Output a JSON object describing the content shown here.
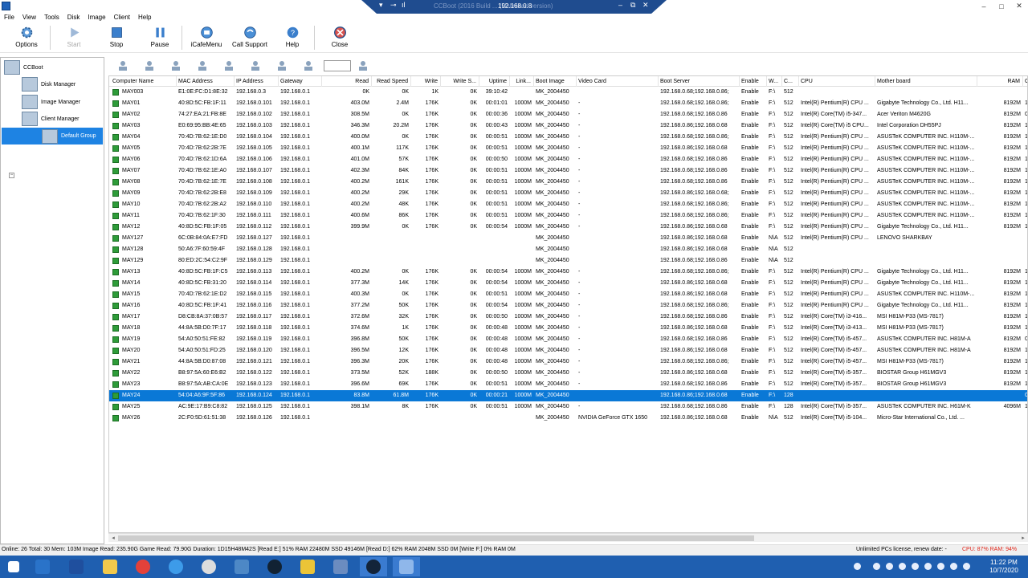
{
  "window": {
    "remote_title": "CCBoot (2016 Build ... (Unlimited version)",
    "remote_ip": "192.168.0.8"
  },
  "menu": [
    "File",
    "View",
    "Tools",
    "Disk",
    "Image",
    "Client",
    "Help"
  ],
  "toolbar": [
    {
      "label": "Options",
      "icon": "gear-icon"
    },
    {
      "label": "Start",
      "icon": "play-icon"
    },
    {
      "label": "Stop",
      "icon": "stop-icon"
    },
    {
      "label": "Pause",
      "icon": "pause-icon"
    },
    {
      "label": "iCafeMenu",
      "icon": "icafe-icon"
    },
    {
      "label": "Call Support",
      "icon": "support-icon"
    },
    {
      "label": "Help",
      "icon": "help-icon"
    },
    {
      "label": "Close",
      "icon": "close-icon"
    }
  ],
  "tree": {
    "root": "CCBoot",
    "disk_manager": "Disk Manager",
    "image_manager": "Image Manager",
    "client_manager": "Client Manager",
    "default_group": "Default Group",
    "expander": "−"
  },
  "columns": [
    "Computer Name",
    "MAC Address",
    "IP Address",
    "Gateway",
    "Read",
    "Read Speed",
    "Write",
    "Write S...",
    "Uptime",
    "Link...",
    "Boot Image",
    "Video Card",
    "Boot Server",
    "Enable",
    "W...",
    "C...",
    "CPU",
    "Mother board",
    "RAM",
    "C"
  ],
  "rows": [
    [
      "MAY003",
      "E1:0E:FC:D1:8E:32",
      "192.168.0.3",
      "192.168.0.1",
      "0K",
      "0K",
      "1K",
      "0K",
      "39:10:42",
      "",
      "MK_2004450",
      "",
      "192.168.0.68;192.168.0.86;",
      "Enable",
      "F:\\",
      "512",
      "",
      "",
      "",
      ""
    ],
    [
      "MAY01",
      "40:8D:5C:FB:1F:11",
      "192.168.0.101",
      "192.168.0.1",
      "403.0M",
      "2.4M",
      "176K",
      "0K",
      "00:01:01",
      "1000M",
      "MK_2004450",
      "-",
      "192.168.0.68;192.168.0.86;",
      "Enable",
      "F:\\",
      "512",
      "Intel(R) Pentium(R) CPU ...",
      "Gigabyte Technology Co., Ltd. H11...",
      "8192M",
      "1"
    ],
    [
      "MAY02",
      "74:27:EA:21:FB:8E",
      "192.168.0.102",
      "192.168.0.1",
      "308.5M",
      "0K",
      "176K",
      "0K",
      "00:00:36",
      "1000M",
      "MK_2004450",
      "-",
      "192.168.0.68;192.168.0.86",
      "Enable",
      "F:\\",
      "512",
      "Intel(R) Core(TM) i5-347...",
      "Acer Veriton M4620G",
      "8192M",
      "0"
    ],
    [
      "MAY03",
      "E0:69:95:BB:4E:65",
      "192.168.0.103",
      "192.168.0.1",
      "346.3M",
      "20.2M",
      "176K",
      "0K",
      "00:00:43",
      "1000M",
      "MK_2004450",
      "-",
      "192.168.0.86;192.168.0.68",
      "Enable",
      "F:\\",
      "512",
      "Intel(R) Core(TM) i5 CPU...",
      "Intel Corporation DH55PJ",
      "8192M",
      "1"
    ],
    [
      "MAY04",
      "70:4D:7B:62:1E:D0",
      "192.168.0.104",
      "192.168.0.1",
      "400.0M",
      "0K",
      "176K",
      "0K",
      "00:00:51",
      "1000M",
      "MK_2004450",
      "-",
      "192.168.0.68;192.168.0.86;",
      "Enable",
      "F:\\",
      "512",
      "Intel(R) Pentium(R) CPU ...",
      "ASUSTeK COMPUTER INC. H110M-...",
      "8192M",
      "1"
    ],
    [
      "MAY05",
      "70:4D:7B:62:2B:7E",
      "192.168.0.105",
      "192.168.0.1",
      "400.1M",
      "117K",
      "176K",
      "0K",
      "00:00:51",
      "1000M",
      "MK_2004450",
      "-",
      "192.168.0.86;192.168.0.68",
      "Enable",
      "F:\\",
      "512",
      "Intel(R) Pentium(R) CPU ...",
      "ASUSTeK COMPUTER INC. H110M-...",
      "8192M",
      "1"
    ],
    [
      "MAY06",
      "70:4D:7B:62:1D:6A",
      "192.168.0.106",
      "192.168.0.1",
      "401.0M",
      "57K",
      "176K",
      "0K",
      "00:00:50",
      "1000M",
      "MK_2004450",
      "-",
      "192.168.0.68;192.168.0.86",
      "Enable",
      "F:\\",
      "512",
      "Intel(R) Pentium(R) CPU ...",
      "ASUSTeK COMPUTER INC. H110M-...",
      "8192M",
      "1"
    ],
    [
      "MAY07",
      "70:4D:7B:62:1E:A0",
      "192.168.0.107",
      "192.168.0.1",
      "402.3M",
      "84K",
      "176K",
      "0K",
      "00:00:51",
      "1000M",
      "MK_2004450",
      "-",
      "192.168.0.68;192.168.0.86",
      "Enable",
      "F:\\",
      "512",
      "Intel(R) Pentium(R) CPU ...",
      "ASUSTeK COMPUTER INC. H110M-...",
      "8192M",
      "1"
    ],
    [
      "MAY08",
      "70:4D:7B:62:1E:7E",
      "192.168.0.108",
      "192.168.0.1",
      "400.2M",
      "161K",
      "176K",
      "0K",
      "00:00:51",
      "1000M",
      "MK_2004450",
      "-",
      "192.168.0.68;192.168.0.86",
      "Enable",
      "F:\\",
      "512",
      "Intel(R) Pentium(R) CPU ...",
      "ASUSTeK COMPUTER INC. H110M-...",
      "8192M",
      "1"
    ],
    [
      "MAY09",
      "70:4D:7B:62:2B:E8",
      "192.168.0.109",
      "192.168.0.1",
      "400.2M",
      "29K",
      "176K",
      "0K",
      "00:00:51",
      "1000M",
      "MK_2004450",
      "-",
      "192.168.0.86;192.168.0.68;",
      "Enable",
      "F:\\",
      "512",
      "Intel(R) Pentium(R) CPU ...",
      "ASUSTeK COMPUTER INC. H110M-...",
      "8192M",
      "1"
    ],
    [
      "MAY10",
      "70:4D:7B:62:2B:A2",
      "192.168.0.110",
      "192.168.0.1",
      "400.2M",
      "48K",
      "176K",
      "0K",
      "00:00:51",
      "1000M",
      "MK_2004450",
      "-",
      "192.168.0.68;192.168.0.86;",
      "Enable",
      "F:\\",
      "512",
      "Intel(R) Pentium(R) CPU ...",
      "ASUSTeK COMPUTER INC. H110M-...",
      "8192M",
      "1"
    ],
    [
      "MAY11",
      "70:4D:7B:62:1F:30",
      "192.168.0.111",
      "192.168.0.1",
      "400.6M",
      "86K",
      "176K",
      "0K",
      "00:00:51",
      "1000M",
      "MK_2004450",
      "-",
      "192.168.0.68;192.168.0.86;",
      "Enable",
      "F:\\",
      "512",
      "Intel(R) Pentium(R) CPU ...",
      "ASUSTeK COMPUTER INC. H110M-...",
      "8192M",
      "1"
    ],
    [
      "MAY12",
      "40:8D:5C:FB:1F:05",
      "192.168.0.112",
      "192.168.0.1",
      "399.9M",
      "0K",
      "176K",
      "0K",
      "00:00:54",
      "1000M",
      "MK_2004450",
      "-",
      "192.168.0.86;192.168.0.68",
      "Enable",
      "F:\\",
      "512",
      "Intel(R) Pentium(R) CPU ...",
      "Gigabyte Technology Co., Ltd. H11...",
      "8192M",
      "1"
    ],
    [
      "MAY127",
      "6C:0B:84:0A:E7:FD",
      "192.168.0.127",
      "192.168.0.1",
      "",
      "",
      "",
      "",
      "",
      "",
      "MK_2004450",
      "",
      "192.168.0.86;192.168.0.68",
      "Enable",
      "N\\A",
      "512",
      "Intel(R) Pentium(R) CPU ...",
      "LENOVO SHARKBAY",
      "",
      ""
    ],
    [
      "MAY128",
      "50:A6:7F:60:59:4F",
      "192.168.0.128",
      "192.168.0.1",
      "",
      "",
      "",
      "",
      "",
      "",
      "MK_2004450",
      "",
      "192.168.0.86;192.168.0.68",
      "Enable",
      "N\\A",
      "512",
      "",
      "",
      "",
      ""
    ],
    [
      "MAY129",
      "80:ED:2C:54:C2:9F",
      "192.168.0.129",
      "192.168.0.1",
      "",
      "",
      "",
      "",
      "",
      "",
      "MK_2004450",
      "",
      "192.168.0.68;192.168.0.86",
      "Enable",
      "N\\A",
      "512",
      "",
      "",
      "",
      ""
    ],
    [
      "MAY13",
      "40:8D:5C:FB:1F:C5",
      "192.168.0.113",
      "192.168.0.1",
      "400.2M",
      "0K",
      "176K",
      "0K",
      "00:00:54",
      "1000M",
      "MK_2004450",
      "-",
      "192.168.0.68;192.168.0.86;",
      "Enable",
      "F:\\",
      "512",
      "Intel(R) Pentium(R) CPU ...",
      "Gigabyte Technology Co., Ltd. H11...",
      "8192M",
      "1"
    ],
    [
      "MAY14",
      "40:8D:5C:FB:31:20",
      "192.168.0.114",
      "192.168.0.1",
      "377.3M",
      "14K",
      "176K",
      "0K",
      "00:00:54",
      "1000M",
      "MK_2004450",
      "-",
      "192.168.0.86;192.168.0.68",
      "Enable",
      "F:\\",
      "512",
      "Intel(R) Pentium(R) CPU ...",
      "Gigabyte Technology Co., Ltd. H11...",
      "8192M",
      "1"
    ],
    [
      "MAY15",
      "70:4D:7B:62:1E:D2",
      "192.168.0.115",
      "192.168.0.1",
      "400.3M",
      "0K",
      "176K",
      "0K",
      "00:00:51",
      "1000M",
      "MK_2004450",
      "-",
      "192.168.0.86;192.168.0.68",
      "Enable",
      "F:\\",
      "512",
      "Intel(R) Pentium(R) CPU ...",
      "ASUSTeK COMPUTER INC. H110M-...",
      "8192M",
      "1"
    ],
    [
      "MAY16",
      "40:8D:5C:FB:1F:41",
      "192.168.0.116",
      "192.168.0.1",
      "377.2M",
      "50K",
      "176K",
      "0K",
      "00:00:54",
      "1000M",
      "MK_2004450",
      "-",
      "192.168.0.68;192.168.0.86;",
      "Enable",
      "F:\\",
      "512",
      "Intel(R) Pentium(R) CPU ...",
      "Gigabyte Technology Co., Ltd. H11...",
      "8192M",
      "1"
    ],
    [
      "MAY17",
      "D8:CB:8A:37:0B:57",
      "192.168.0.117",
      "192.168.0.1",
      "372.6M",
      "32K",
      "176K",
      "0K",
      "00:00:50",
      "1000M",
      "MK_2004450",
      "-",
      "192.168.0.68;192.168.0.86",
      "Enable",
      "F:\\",
      "512",
      "Intel(R) Core(TM) i3-416...",
      "MSI H81M-P33 (MS-7817)",
      "8192M",
      "1"
    ],
    [
      "MAY18",
      "44:8A:5B:D0:7F:17",
      "192.168.0.118",
      "192.168.0.1",
      "374.6M",
      "1K",
      "176K",
      "0K",
      "00:00:48",
      "1000M",
      "MK_2004450",
      "-",
      "192.168.0.86;192.168.0.68",
      "Enable",
      "F:\\",
      "512",
      "Intel(R) Core(TM) i3-413...",
      "MSI H81M-P33 (MS-7817)",
      "8192M",
      "1"
    ],
    [
      "MAY19",
      "54:A0:50:51:FE:82",
      "192.168.0.119",
      "192.168.0.1",
      "396.8M",
      "50K",
      "176K",
      "0K",
      "00:00:48",
      "1000M",
      "MK_2004450",
      "-",
      "192.168.0.68;192.168.0.86",
      "Enable",
      "F:\\",
      "512",
      "Intel(R) Core(TM) i5-457...",
      "ASUSTeK COMPUTER INC. H81M-A",
      "8192M",
      "0"
    ],
    [
      "MAY20",
      "54:A0:50:51:FD:25",
      "192.168.0.120",
      "192.168.0.1",
      "396.5M",
      "12K",
      "176K",
      "0K",
      "00:00:48",
      "1000M",
      "MK_2004450",
      "-",
      "192.168.0.86;192.168.0.68",
      "Enable",
      "F:\\",
      "512",
      "Intel(R) Core(TM) i5-457...",
      "ASUSTeK COMPUTER INC. H81M-A",
      "8192M",
      "1"
    ],
    [
      "MAY21",
      "44:8A:5B:D0:87:08",
      "192.168.0.121",
      "192.168.0.1",
      "396.3M",
      "20K",
      "176K",
      "0K",
      "00:00:48",
      "1000M",
      "MK_2004450",
      "-",
      "192.168.0.68;192.168.0.86;",
      "Enable",
      "F:\\",
      "512",
      "Intel(R) Core(TM) i5-457...",
      "MSI H81M-P33 (MS-7817)",
      "8192M",
      "1"
    ],
    [
      "MAY22",
      "B8:97:5A:60:E6:B2",
      "192.168.0.122",
      "192.168.0.1",
      "373.5M",
      "52K",
      "188K",
      "0K",
      "00:00:50",
      "1000M",
      "MK_2004450",
      "-",
      "192.168.0.86;192.168.0.68",
      "Enable",
      "F:\\",
      "512",
      "Intel(R) Core(TM) i5-357...",
      "BIOSTAR Group H61MGV3",
      "8192M",
      "1"
    ],
    [
      "MAY23",
      "B8:97:5A:AB:CA:0E",
      "192.168.0.123",
      "192.168.0.1",
      "396.6M",
      "69K",
      "176K",
      "0K",
      "00:00:51",
      "1000M",
      "MK_2004450",
      "-",
      "192.168.0.68;192.168.0.86",
      "Enable",
      "F:\\",
      "512",
      "Intel(R) Core(TM) i5-357...",
      "BIOSTAR Group H61MGV3",
      "8192M",
      "1"
    ],
    [
      "MAY24",
      "54:04:A6:9F:5F:86",
      "192.168.0.124",
      "192.168.0.1",
      "83.8M",
      "61.8M",
      "176K",
      "0K",
      "00:00:21",
      "1000M",
      "MK_2004450",
      "",
      "192.168.0.86;192.168.0.68",
      "Enable",
      "F:\\",
      "128",
      "",
      "",
      "",
      "0"
    ],
    [
      "MAY25",
      "AC:9E:17:B9:C8:82",
      "192.168.0.125",
      "192.168.0.1",
      "398.1M",
      "8K",
      "176K",
      "0K",
      "00:00:51",
      "1000M",
      "MK_2004450",
      "-",
      "192.168.0.68;192.168.0.86",
      "Enable",
      "F:\\",
      "128",
      "Intel(R) Core(TM) i5-357...",
      "ASUSTeK COMPUTER INC. H61M-K",
      "4096M",
      "1"
    ],
    [
      "MAY26",
      "2C:F0:5D:61:51:38",
      "192.168.0.126",
      "192.168.0.1",
      "",
      "",
      "",
      "",
      "",
      "",
      "MK_2004450",
      "NVIDIA GeForce GTX 1650",
      "192.168.0.86;192.168.0.68",
      "Enable",
      "N\\A",
      "512",
      "Intel(R) Core(TM) i5-104...",
      "Micro-Star International Co., Ltd. ...",
      "",
      ""
    ]
  ],
  "selected_row": 27,
  "status": {
    "left": "Online: 26 Total: 30 Mem: 103M Image Read: 235.90G Game Read: 79.90G Duration: 1D15H48M42S [Read E:] 51% RAM 22480M SSD 49146M [Read D:] 62% RAM 2048M SSD 0M [Write F:] 0% RAM 0M",
    "license": "Unlimited PCs license, renew date: -",
    "cpu": "CPU: 87% RAM: 94%"
  },
  "clock": {
    "time": "11:22 PM",
    "date": "10/7/2020"
  },
  "colors": {
    "selection": "#0a78d6",
    "tree_selection": "#1e83e3",
    "taskbar": "#1f5fb0",
    "cpu_warning": "#e0261a"
  }
}
